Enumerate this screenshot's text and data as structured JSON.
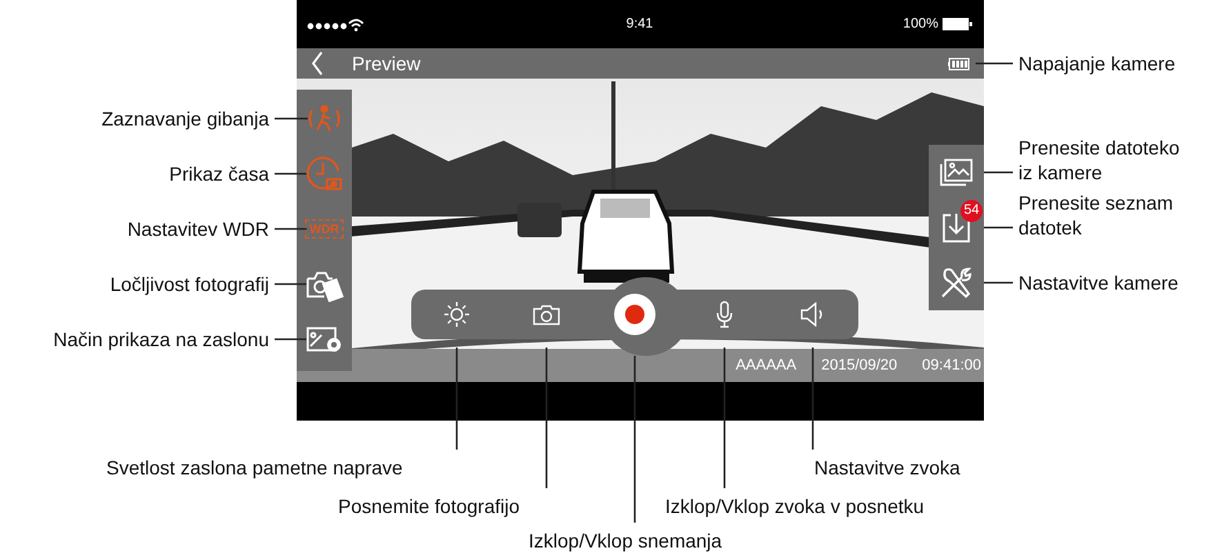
{
  "status_bar": {
    "time": "9:41",
    "battery": "100%"
  },
  "header": {
    "title": "Preview",
    "battery_callout": "Napajanje kamere"
  },
  "left_tools": [
    {
      "kind": "motion",
      "on": true,
      "callout": "Zaznavanje gibanja"
    },
    {
      "kind": "clock",
      "on": true,
      "callout": "Prikaz časa"
    },
    {
      "kind": "wdr",
      "on": true,
      "text": "WDR",
      "callout": "Nastavitev WDR"
    },
    {
      "on": false,
      "callout": "Ločljivost fotografij"
    },
    {
      "kind": "display",
      "on": false,
      "callout": "Način prikaza na zaslonu"
    }
  ],
  "right_tools": [
    {
      "kind": "gallery",
      "callout": "Prenesite datoteko iz kamere"
    },
    {
      "kind": "download",
      "badge": "54",
      "callout": "Prenesite seznam datotek"
    },
    {
      "kind": "settings",
      "callout": "Nastavitve kamere"
    }
  ],
  "controls": [
    {
      "kind": "brightness"
    },
    {
      "kind": "camera"
    },
    {
      "kind": "record"
    },
    {
      "kind": "mic"
    },
    {
      "kind": "speaker"
    }
  ],
  "control_callouts": [
    {
      "kind": "brightness",
      "text": "Svetlost zaslona pametne naprave"
    },
    {
      "kind": "speaker",
      "text": "Nastavitve zvoka"
    },
    {
      "kind": "camera",
      "text": "Posnemite fotografijo"
    },
    {
      "kind": "mic",
      "text": "Izklop/Vklop zvoka v posnetku"
    },
    {
      "kind": "record",
      "text": "Izklop/Vklop snemanja"
    }
  ],
  "overlay": {
    "name": "AAAAAA",
    "date": "2015/09/20",
    "time": "09:41:00"
  }
}
